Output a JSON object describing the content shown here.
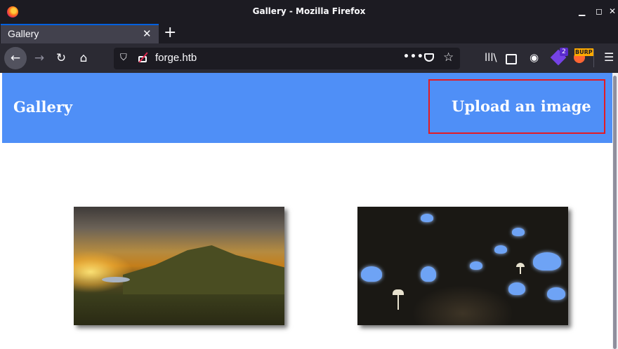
{
  "window": {
    "title": "Gallery - Mozilla Firefox",
    "minimize": "▁",
    "maximize": "◻",
    "close": "✕"
  },
  "tabs": [
    {
      "label": "Gallery",
      "close": "✕"
    }
  ],
  "new_tab": "+",
  "nav": {
    "back": "←",
    "forward": "→",
    "reload": "↻",
    "home": "⌂",
    "url": "forge.htb",
    "page_actions": "•••",
    "bookmark": "☆",
    "library": "lll\\",
    "account": "◉",
    "menu": "☰"
  },
  "extensions": {
    "badge_count": "2",
    "burp_label": "BURP"
  },
  "page": {
    "brand": "Gallery",
    "upload_link": "Upload an image"
  },
  "images": [
    {
      "name": "landscape"
    },
    {
      "name": "butterflies"
    }
  ],
  "colors": {
    "header_blue": "#4f8ff7",
    "highlight_red": "#e31b23",
    "tab_accent": "#0060df"
  }
}
